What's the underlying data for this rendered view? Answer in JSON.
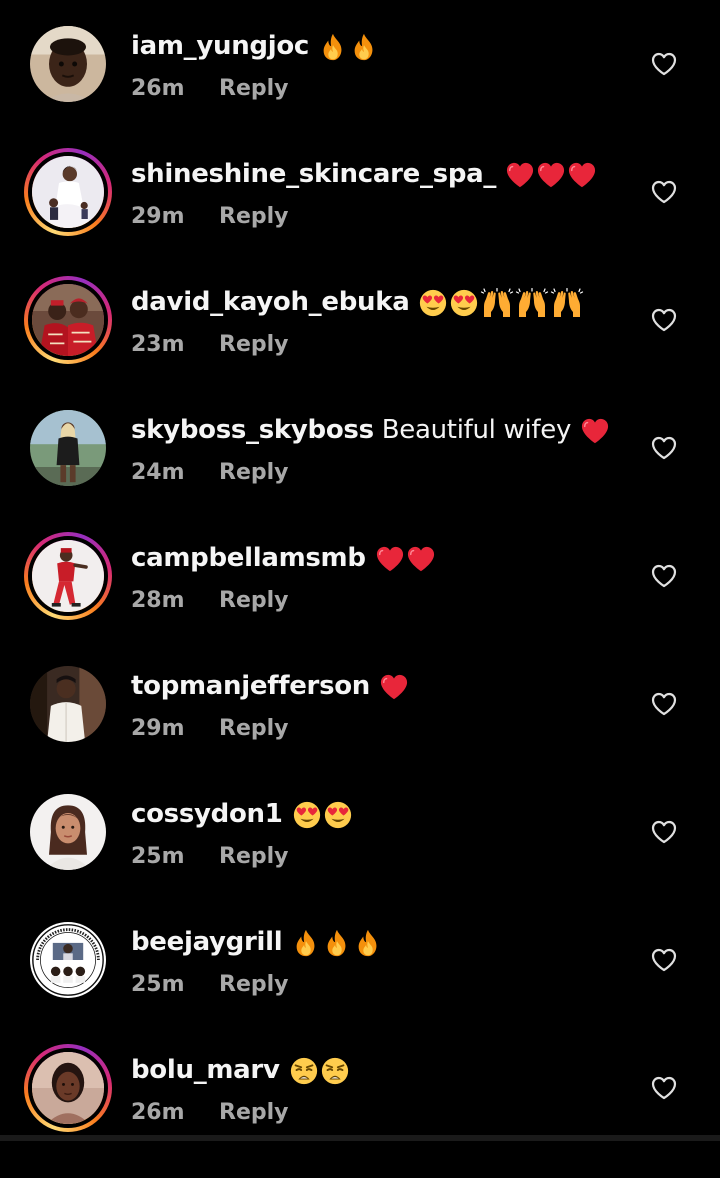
{
  "comments": [
    {
      "username": "iam_yungjoc",
      "text": "",
      "emojis": [
        "fire",
        "fire"
      ],
      "time": "26m",
      "reply": "Reply",
      "story_ring": false,
      "avatar": "child-portrait"
    },
    {
      "username": "shineshine_skincare_spa_",
      "text": "",
      "emojis": [
        "red-heart",
        "red-heart",
        "red-heart"
      ],
      "time": "29m",
      "reply": "Reply",
      "story_ring": true,
      "avatar": "woman-in-white-dress"
    },
    {
      "username": "david_kayoh_ebuka",
      "text": "",
      "emojis": [
        "heart-eyes",
        "heart-eyes",
        "raising-hands",
        "raising-hands",
        "raising-hands"
      ],
      "time": "23m",
      "reply": "Reply",
      "story_ring": true,
      "avatar": "couple-in-red"
    },
    {
      "username": "skyboss_skyboss",
      "text": "Beautiful wifey",
      "emojis": [
        "red-heart"
      ],
      "time": "24m",
      "reply": "Reply",
      "story_ring": false,
      "avatar": "woman-standing-outdoors"
    },
    {
      "username": "campbellamsmb",
      "text": "",
      "emojis": [
        "red-heart",
        "red-heart"
      ],
      "time": "28m",
      "reply": "Reply",
      "story_ring": true,
      "avatar": "man-in-red-outfit"
    },
    {
      "username": "topmanjefferson",
      "text": "",
      "emojis": [
        "red-heart"
      ],
      "time": "29m",
      "reply": "Reply",
      "story_ring": false,
      "avatar": "man-in-white-shirt"
    },
    {
      "username": "cossydon1",
      "text": "",
      "emojis": [
        "heart-eyes",
        "heart-eyes"
      ],
      "time": "25m",
      "reply": "Reply",
      "story_ring": false,
      "avatar": "woman-portrait"
    },
    {
      "username": "beejaygrill",
      "text": "",
      "emojis": [
        "fire",
        "fire",
        "fire"
      ],
      "time": "25m",
      "reply": "Reply",
      "story_ring": false,
      "avatar": "circular-logo"
    },
    {
      "username": "bolu_marv",
      "text": "",
      "emojis": [
        "weary-face",
        "weary-face"
      ],
      "time": "26m",
      "reply": "Reply",
      "story_ring": true,
      "avatar": "woman-portrait-dark"
    }
  ],
  "colors": {
    "background": "#000000",
    "username": "#f5f5f5",
    "meta": "#a8a8a8",
    "like_icon": "#e0e0e0"
  },
  "icons": {
    "like": "heart-outline-icon"
  }
}
